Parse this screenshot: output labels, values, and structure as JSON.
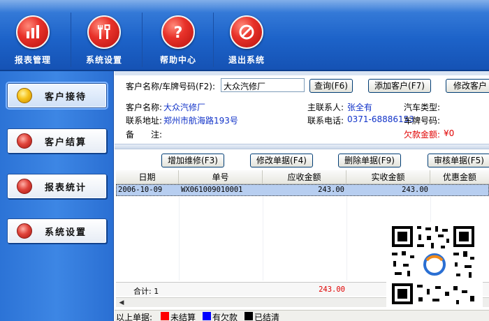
{
  "toolbar": {
    "items": [
      {
        "label": "报表管理",
        "icon": "bar-chart-icon"
      },
      {
        "label": "系统设置",
        "icon": "tools-icon"
      },
      {
        "label": "帮助中心",
        "icon": "help-icon"
      },
      {
        "label": "退出系统",
        "icon": "exit-icon"
      }
    ]
  },
  "sidebar": {
    "items": [
      {
        "label": "客户接待",
        "active": true,
        "dot": "yellow"
      },
      {
        "label": "客户结算",
        "active": false,
        "dot": "red"
      },
      {
        "label": "报表统计",
        "active": false,
        "dot": "red"
      },
      {
        "label": "系统设置",
        "active": false,
        "dot": "red"
      }
    ]
  },
  "search": {
    "label": "客户名称/车牌号码(F2):",
    "value": "大众汽修厂",
    "query_button": "查询(F6)",
    "add_button": "添加客户(F7)",
    "edit_button": "修改客户"
  },
  "customer": {
    "name_label": "客户名称:",
    "name_value": "大众汽修厂",
    "address_label": "联系地址:",
    "address_value": "郑州市航海路193号",
    "note_label": "备　　注:",
    "contact_label": "主联系人:",
    "contact_value": "张全有",
    "phone_label": "联系电话:",
    "phone_value": "0371-68886153",
    "cartype_label": "汽车类型:",
    "plate_label": "车牌号码:",
    "debt_label": "欠款金额:",
    "debt_value": "¥0"
  },
  "actions": {
    "add_repair": "增加维修(F3)",
    "edit_order": "修改单据(F4)",
    "delete_order": "删除单据(F9)",
    "audit_order": "审核单据(F5)"
  },
  "table": {
    "headers": [
      "日期",
      "单号",
      "应收金额",
      "实收金额",
      "优惠金额"
    ],
    "rows": [
      [
        "2006-10-09",
        "WX061009010001",
        "243.00",
        "243.00",
        ""
      ]
    ],
    "total_label": "合计: 1",
    "total_receivable": "243.00"
  },
  "legend": {
    "title": "以上单据:",
    "items": [
      {
        "label": "未结算",
        "color": "#ff0000"
      },
      {
        "label": "有欠款",
        "color": "#0000ff"
      },
      {
        "label": "已结清",
        "color": "#000000"
      }
    ]
  }
}
